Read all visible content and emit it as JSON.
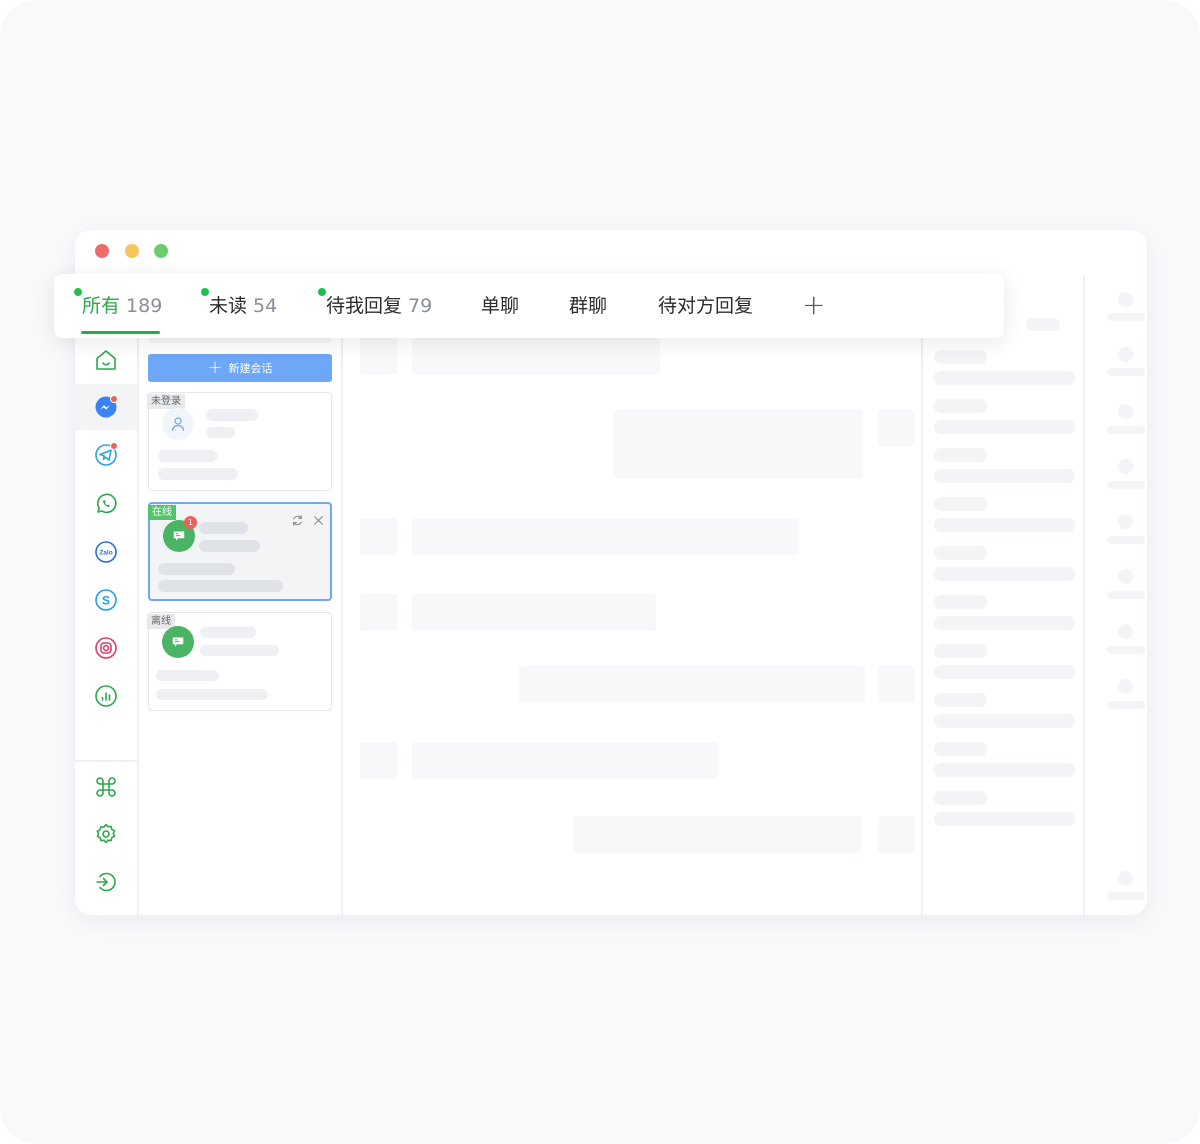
{
  "tabs": [
    {
      "label": "所有",
      "count": "189",
      "active": true,
      "dot": true
    },
    {
      "label": "未读",
      "count": "54",
      "active": false,
      "dot": true
    },
    {
      "label": "待我回复",
      "count": "79",
      "active": false,
      "dot": true
    },
    {
      "label": "单聊",
      "count": "",
      "active": false,
      "dot": false
    },
    {
      "label": "群聊",
      "count": "",
      "active": false,
      "dot": false
    },
    {
      "label": "待对方回复",
      "count": "",
      "active": false,
      "dot": false
    }
  ],
  "tabs_add_label": "+",
  "window_controls": {
    "close": "#ec6b6b",
    "minimize": "#f5c660",
    "maximize": "#6ccc6c"
  },
  "sidebar": {
    "items": [
      {
        "icon": "home-icon",
        "color": "#2aa84a"
      },
      {
        "icon": "messenger-icon",
        "color": "#3b82f6",
        "badge": true,
        "active": true
      },
      {
        "icon": "telegram-icon",
        "color": "#2aa3e0",
        "badge": true
      },
      {
        "icon": "whatsapp-icon",
        "color": "#2aa84a"
      },
      {
        "icon": "zalo-icon",
        "color": "#2a6ed8",
        "text": "Zalo"
      },
      {
        "icon": "skype-icon",
        "color": "#1ea0e8",
        "text": "S"
      },
      {
        "icon": "instagram-icon",
        "color": "#e23a6a"
      },
      {
        "icon": "analytics-icon",
        "color": "#2aa84a"
      }
    ],
    "bottom": [
      {
        "icon": "command-icon",
        "color": "#2aa84a"
      },
      {
        "icon": "settings-icon",
        "color": "#2aa84a"
      },
      {
        "icon": "logout-icon",
        "color": "#2aa84a"
      }
    ]
  },
  "conversations": {
    "new_button": "新建会话",
    "cards": [
      {
        "status": "未登录",
        "kind": "user"
      },
      {
        "status": "在线",
        "kind": "whatsapp",
        "unread": "1",
        "selected": true
      },
      {
        "status": "离线",
        "kind": "whatsapp"
      }
    ]
  },
  "colors": {
    "accent": "#2aa84a",
    "primary": "#6ea6f8",
    "badge": "#f0605a"
  }
}
